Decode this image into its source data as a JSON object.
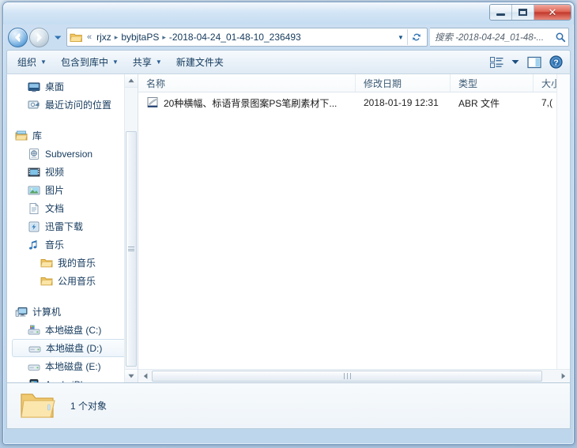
{
  "window": {
    "controls": {
      "minimize": "–",
      "maximize": "□",
      "close": "✕"
    }
  },
  "address": {
    "root_chevron": "«",
    "crumbs": [
      "rjxz",
      "bybjtaPS",
      "-2018-04-24_01-48-10_236493"
    ],
    "separator": "▸",
    "dropdown": "▼"
  },
  "search": {
    "placeholder": "搜索 -2018-04-24_01-48-...",
    "icon": "search-icon"
  },
  "toolbar": {
    "organize": "组织",
    "include_in_library": "包含到库中",
    "share": "共享",
    "new_folder": "新建文件夹",
    "caret": "▼"
  },
  "sidebar": {
    "items": [
      {
        "label": "桌面",
        "icon": "desktop-icon",
        "indent": 1,
        "selected": false
      },
      {
        "label": "最近访问的位置",
        "icon": "recent-places-icon",
        "indent": 1,
        "selected": false
      },
      {
        "label": "库",
        "icon": "library-icon",
        "indent": 0,
        "selected": false
      },
      {
        "label": "Subversion",
        "icon": "subversion-icon",
        "indent": 1,
        "selected": false
      },
      {
        "label": "视频",
        "icon": "video-icon",
        "indent": 1,
        "selected": false
      },
      {
        "label": "图片",
        "icon": "pictures-icon",
        "indent": 1,
        "selected": false
      },
      {
        "label": "文档",
        "icon": "documents-icon",
        "indent": 1,
        "selected": false
      },
      {
        "label": "迅雷下载",
        "icon": "thunder-download-icon",
        "indent": 1,
        "selected": false
      },
      {
        "label": "音乐",
        "icon": "music-icon",
        "indent": 1,
        "selected": false
      },
      {
        "label": "我的音乐",
        "icon": "folder-icon",
        "indent": 2,
        "selected": false
      },
      {
        "label": "公用音乐",
        "icon": "folder-icon",
        "indent": 2,
        "selected": false
      },
      {
        "label": "计算机",
        "icon": "computer-icon",
        "indent": 0,
        "selected": false
      },
      {
        "label": "本地磁盘 (C:)",
        "icon": "system-drive-icon",
        "indent": 1,
        "selected": false
      },
      {
        "label": "本地磁盘 (D:)",
        "icon": "drive-icon",
        "indent": 1,
        "selected": true
      },
      {
        "label": "本地磁盘 (E:)",
        "icon": "drive-icon",
        "indent": 1,
        "selected": false
      },
      {
        "label": "Apple iPhone",
        "icon": "iphone-icon",
        "indent": 1,
        "selected": false
      }
    ]
  },
  "filelist": {
    "columns": [
      "名称",
      "修改日期",
      "类型",
      "大小"
    ],
    "rows": [
      {
        "name": "20种横幅、标语背景图案PS笔刷素材下...",
        "date": "2018-01-19 12:31",
        "type": "ABR 文件",
        "size": "7,(",
        "icon": "abr-file-icon"
      }
    ]
  },
  "status": {
    "count": "1 个对象",
    "icon": "folder-large-icon"
  },
  "colors": {
    "accent": "#2f74b4",
    "close_button": "#c2392c",
    "crumb_text": "#14395c",
    "selection_bg": "#eef5fb"
  }
}
